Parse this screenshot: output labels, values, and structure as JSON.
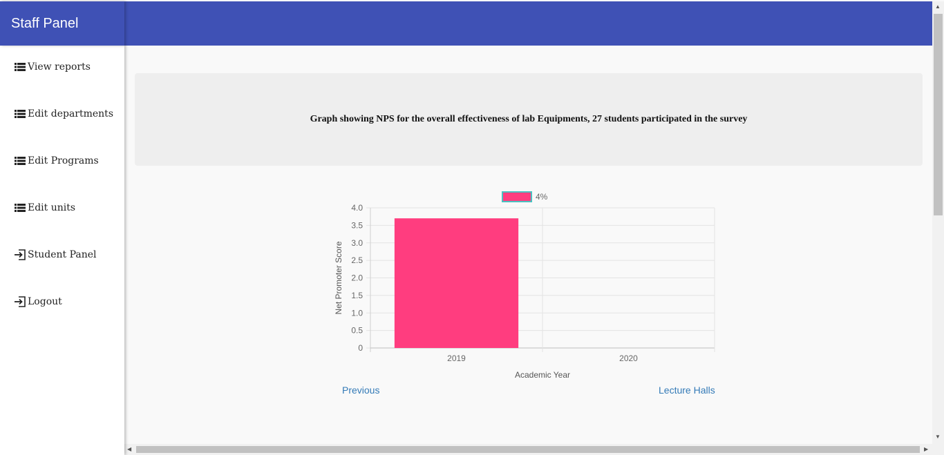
{
  "app": {
    "title": "Staff Panel",
    "header_color": "#3f51b5"
  },
  "sidebar": {
    "items": [
      {
        "label": "View reports",
        "icon": "list-icon"
      },
      {
        "label": "Edit departments",
        "icon": "list-icon"
      },
      {
        "label": "Edit Programs",
        "icon": "list-icon"
      },
      {
        "label": "Edit units",
        "icon": "list-icon"
      },
      {
        "label": "Student Panel",
        "icon": "sign-in-icon"
      },
      {
        "label": "Logout",
        "icon": "sign-in-icon"
      }
    ]
  },
  "main": {
    "banner_title": "Graph showing NPS for the overall effectiveness of lab Equipments, 27 students participated in the survey",
    "previous_label": "Previous",
    "next_label": "Lecture Halls"
  },
  "chart_data": {
    "type": "bar",
    "categories": [
      "2019",
      "2020"
    ],
    "series": [
      {
        "name": "4%",
        "values": [
          3.7,
          0
        ],
        "color": "#ff3d7f",
        "border": "#4bc0c0"
      }
    ],
    "xlabel": "Academic Year",
    "ylabel": "Net Promoter Score",
    "ylim": [
      0,
      4.0
    ],
    "yticks": [
      "0",
      "0.5",
      "1.0",
      "1.5",
      "2.0",
      "2.5",
      "3.0",
      "3.5",
      "4.0"
    ],
    "grid": true,
    "legend": "top"
  }
}
